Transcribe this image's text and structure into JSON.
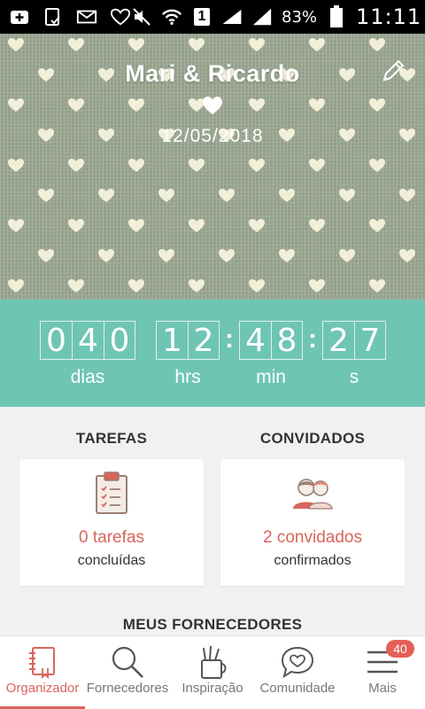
{
  "status_bar": {
    "battery": "83%",
    "time": "11:11",
    "sim_label": "1",
    "icons": [
      "add-box-icon",
      "clipboard-check-icon",
      "mail-icon",
      "heart-outline-icon",
      "mute-icon",
      "wifi-icon",
      "sim-icon",
      "signal-icon",
      "battery-icon"
    ]
  },
  "header": {
    "title": "Mari & Ricardo",
    "date": "12/05/2018",
    "edit_icon": "pencil-icon",
    "heart_icon": "heart-icon"
  },
  "countdown": {
    "days_digits": [
      "0",
      "4",
      "0"
    ],
    "hours_digits": [
      "1",
      "2"
    ],
    "minutes_digits": [
      "4",
      "8"
    ],
    "seconds_digits": [
      "2",
      "7"
    ],
    "labels": {
      "days": "dias",
      "hours": "hrs",
      "minutes": "min",
      "seconds": "s"
    }
  },
  "tasks": {
    "title": "TAREFAS",
    "value": "0 tarefas",
    "caption": "concluídas",
    "icon": "clipboard-icon"
  },
  "guests": {
    "title": "CONVIDADOS",
    "value": "2 convidados",
    "caption": "confirmados",
    "icon": "couple-icon"
  },
  "suppliers_section": {
    "title": "MEUS FORNECEDORES"
  },
  "nav": {
    "items": [
      {
        "label": "Organizador",
        "icon": "notebook-icon",
        "active": true
      },
      {
        "label": "Fornecedores",
        "icon": "search-icon",
        "active": false
      },
      {
        "label": "Inspiração",
        "icon": "pencil-cup-icon",
        "active": false
      },
      {
        "label": "Comunidade",
        "icon": "chat-heart-icon",
        "active": false
      },
      {
        "label": "Mais",
        "icon": "menu-icon",
        "active": false,
        "badge": "40"
      }
    ]
  },
  "colors": {
    "accent": "#d9655b",
    "countdown_bg": "#6fc5b4",
    "page_bg": "#f1f1f1",
    "header_bg": "#9aa591",
    "header_hearts": "#f2efd9"
  }
}
